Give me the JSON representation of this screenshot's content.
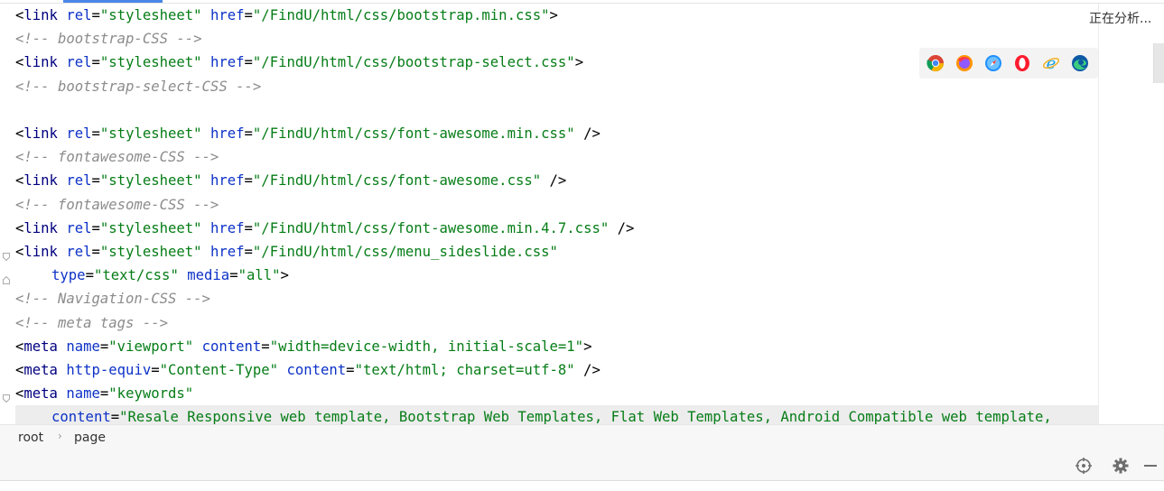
{
  "editor": {
    "lines": [
      {
        "type": "tag",
        "parts": [
          [
            "t",
            "<"
          ],
          [
            "tag",
            "link "
          ],
          [
            "at",
            "rel"
          ],
          [
            "eq",
            "="
          ],
          [
            "str",
            "\"stylesheet\" "
          ],
          [
            "at",
            "href"
          ],
          [
            "eq",
            "="
          ],
          [
            "str",
            "\"/FindU/html/css/bootstrap.min.css\""
          ],
          [
            "t",
            ">"
          ]
        ]
      },
      {
        "type": "comment",
        "text": "<!-- bootstrap-CSS -->"
      },
      {
        "type": "tag",
        "parts": [
          [
            "t",
            "<"
          ],
          [
            "tag",
            "link "
          ],
          [
            "at",
            "rel"
          ],
          [
            "eq",
            "="
          ],
          [
            "str",
            "\"stylesheet\" "
          ],
          [
            "at",
            "href"
          ],
          [
            "eq",
            "="
          ],
          [
            "str",
            "\"/FindU/html/css/bootstrap-select.css\""
          ],
          [
            "t",
            ">"
          ]
        ]
      },
      {
        "type": "comment",
        "text": "<!-- bootstrap-select-CSS -->"
      },
      {
        "type": "blank"
      },
      {
        "type": "tag",
        "parts": [
          [
            "t",
            "<"
          ],
          [
            "tag",
            "link "
          ],
          [
            "at",
            "rel"
          ],
          [
            "eq",
            "="
          ],
          [
            "str",
            "\"stylesheet\" "
          ],
          [
            "at",
            "href"
          ],
          [
            "eq",
            "="
          ],
          [
            "str",
            "\"/FindU/html/css/font-awesome.min.css\""
          ],
          [
            "t",
            " />"
          ]
        ]
      },
      {
        "type": "comment",
        "text": "<!-- fontawesome-CSS -->"
      },
      {
        "type": "tag",
        "parts": [
          [
            "t",
            "<"
          ],
          [
            "tag",
            "link "
          ],
          [
            "at",
            "rel"
          ],
          [
            "eq",
            "="
          ],
          [
            "str",
            "\"stylesheet\" "
          ],
          [
            "at",
            "href"
          ],
          [
            "eq",
            "="
          ],
          [
            "str",
            "\"/FindU/html/css/font-awesome.css\""
          ],
          [
            "t",
            " />"
          ]
        ]
      },
      {
        "type": "comment",
        "text": "<!-- fontawesome-CSS -->"
      },
      {
        "type": "tag",
        "parts": [
          [
            "t",
            "<"
          ],
          [
            "tag",
            "link "
          ],
          [
            "at",
            "rel"
          ],
          [
            "eq",
            "="
          ],
          [
            "str",
            "\"stylesheet\" "
          ],
          [
            "at",
            "href"
          ],
          [
            "eq",
            "="
          ],
          [
            "str",
            "\"/FindU/html/css/font-awesome.min.4.7.css\""
          ],
          [
            "t",
            " />"
          ]
        ]
      },
      {
        "type": "tag",
        "fold": "open",
        "parts": [
          [
            "t",
            "<"
          ],
          [
            "tag",
            "link "
          ],
          [
            "at",
            "rel"
          ],
          [
            "eq",
            "="
          ],
          [
            "str",
            "\"stylesheet\" "
          ],
          [
            "at",
            "href"
          ],
          [
            "eq",
            "="
          ],
          [
            "str",
            "\"/FindU/html/css/menu_sideslide.css\""
          ]
        ]
      },
      {
        "type": "tag",
        "fold": "close",
        "indent": true,
        "parts": [
          [
            "at",
            "type"
          ],
          [
            "eq",
            "="
          ],
          [
            "str",
            "\"text/css\" "
          ],
          [
            "at",
            "media"
          ],
          [
            "eq",
            "="
          ],
          [
            "str",
            "\"all\""
          ],
          [
            "t",
            ">"
          ]
        ]
      },
      {
        "type": "comment",
        "text": "<!-- Navigation-CSS -->"
      },
      {
        "type": "comment",
        "text": "<!-- meta tags -->"
      },
      {
        "type": "tag",
        "parts": [
          [
            "t",
            "<"
          ],
          [
            "tag",
            "meta "
          ],
          [
            "at",
            "name"
          ],
          [
            "eq",
            "="
          ],
          [
            "str",
            "\"viewport\" "
          ],
          [
            "at",
            "content"
          ],
          [
            "eq",
            "="
          ],
          [
            "str",
            "\"width=device-width, initial-scale=1\""
          ],
          [
            "t",
            ">"
          ]
        ]
      },
      {
        "type": "tag",
        "parts": [
          [
            "t",
            "<"
          ],
          [
            "tag",
            "meta "
          ],
          [
            "at",
            "http-equiv"
          ],
          [
            "eq",
            "="
          ],
          [
            "str",
            "\"Content-Type\" "
          ],
          [
            "at",
            "content"
          ],
          [
            "eq",
            "="
          ],
          [
            "str",
            "\"text/html; charset=utf-8\""
          ],
          [
            "t",
            " />"
          ]
        ]
      },
      {
        "type": "tag",
        "fold": "open",
        "parts": [
          [
            "t",
            "<"
          ],
          [
            "tag",
            "meta "
          ],
          [
            "at",
            "name"
          ],
          [
            "eq",
            "="
          ],
          [
            "str",
            "\"keywords\""
          ]
        ]
      },
      {
        "type": "tag",
        "indent": true,
        "last": true,
        "parts": [
          [
            "at",
            "content"
          ],
          [
            "eq",
            "="
          ],
          [
            "str",
            "\"Resale Responsive web template, Bootstrap Web Templates, Flat Web Templates, Android Compatible web template,"
          ]
        ]
      }
    ]
  },
  "status": {
    "analyzing_text": "正在分析..."
  },
  "browser_icons": [
    {
      "name": "chrome-icon"
    },
    {
      "name": "firefox-icon"
    },
    {
      "name": "safari-icon"
    },
    {
      "name": "opera-icon"
    },
    {
      "name": "ie-icon"
    },
    {
      "name": "edge-icon"
    }
  ],
  "breadcrumb": {
    "items": [
      "root",
      "page"
    ]
  },
  "colors": {
    "tag": "#000080",
    "attribute": "#0d32c8",
    "string": "#067d17",
    "comment": "#8c8c8c",
    "accent": "#4a86e8"
  }
}
